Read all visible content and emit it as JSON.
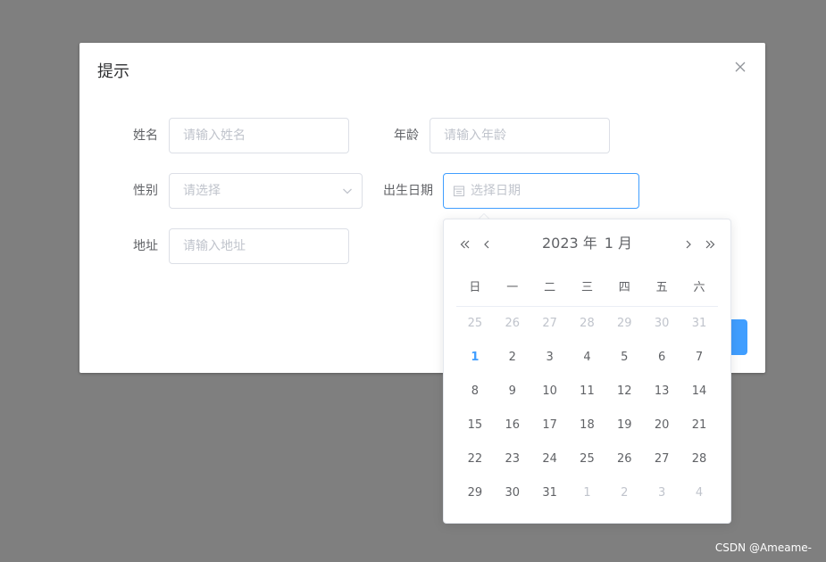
{
  "dialog": {
    "title": "提示"
  },
  "form": {
    "name": {
      "label": "姓名",
      "placeholder": "请输入姓名"
    },
    "age": {
      "label": "年龄",
      "placeholder": "请输入年龄"
    },
    "gender": {
      "label": "性别",
      "placeholder": "请选择"
    },
    "birthday": {
      "label": "出生日期",
      "placeholder": "选择日期"
    },
    "address": {
      "label": "地址",
      "placeholder": "请输入地址"
    }
  },
  "datepicker": {
    "year_text": "2023 年",
    "month_text": "1 月",
    "weekdays": [
      "日",
      "一",
      "二",
      "三",
      "四",
      "五",
      "六"
    ],
    "weeks": [
      [
        {
          "d": "25",
          "o": true
        },
        {
          "d": "26",
          "o": true
        },
        {
          "d": "27",
          "o": true
        },
        {
          "d": "28",
          "o": true
        },
        {
          "d": "29",
          "o": true
        },
        {
          "d": "30",
          "o": true
        },
        {
          "d": "31",
          "o": true
        }
      ],
      [
        {
          "d": "1",
          "today": true
        },
        {
          "d": "2"
        },
        {
          "d": "3"
        },
        {
          "d": "4"
        },
        {
          "d": "5"
        },
        {
          "d": "6"
        },
        {
          "d": "7"
        }
      ],
      [
        {
          "d": "8"
        },
        {
          "d": "9"
        },
        {
          "d": "10"
        },
        {
          "d": "11"
        },
        {
          "d": "12"
        },
        {
          "d": "13"
        },
        {
          "d": "14"
        }
      ],
      [
        {
          "d": "15"
        },
        {
          "d": "16"
        },
        {
          "d": "17"
        },
        {
          "d": "18"
        },
        {
          "d": "19"
        },
        {
          "d": "20"
        },
        {
          "d": "21"
        }
      ],
      [
        {
          "d": "22"
        },
        {
          "d": "23"
        },
        {
          "d": "24"
        },
        {
          "d": "25"
        },
        {
          "d": "26"
        },
        {
          "d": "27"
        },
        {
          "d": "28"
        }
      ],
      [
        {
          "d": "29"
        },
        {
          "d": "30"
        },
        {
          "d": "31"
        },
        {
          "d": "1",
          "o": true
        },
        {
          "d": "2",
          "o": true
        },
        {
          "d": "3",
          "o": true
        },
        {
          "d": "4",
          "o": true
        }
      ]
    ]
  },
  "colors": {
    "accent": "#409eff",
    "overlay": "#7f7f7f",
    "border": "#dcdfe6",
    "placeholder": "#c0c4cc"
  },
  "icons": {
    "close": "close-icon",
    "select_arrow": "chevron-down-icon",
    "date": "calendar-icon",
    "prev_year": "double-chevron-left-icon",
    "prev_month": "chevron-left-icon",
    "next_month": "chevron-right-icon",
    "next_year": "double-chevron-right-icon"
  },
  "watermark": "CSDN @Ameame-"
}
